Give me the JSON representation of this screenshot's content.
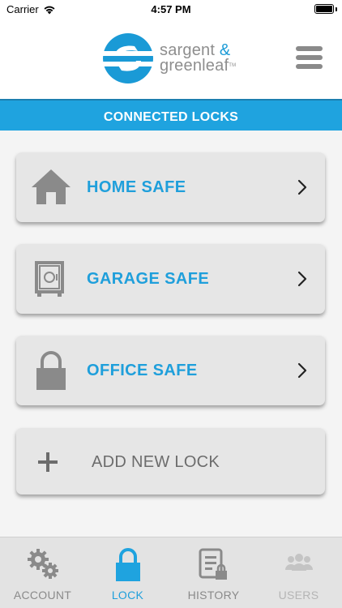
{
  "status_bar": {
    "carrier": "Carrier",
    "time": "4:57 PM"
  },
  "header": {
    "logo_line1": "sargent",
    "logo_amp": "&",
    "logo_line2": "greenleaf",
    "logo_tm": "TM",
    "menu_icon": "hamburger-menu-icon"
  },
  "section_title": "CONNECTED LOCKS",
  "locks": [
    {
      "label": "HOME SAFE",
      "icon": "house-icon"
    },
    {
      "label": "GARAGE SAFE",
      "icon": "safe-icon"
    },
    {
      "label": "OFFICE SAFE",
      "icon": "padlock-icon"
    }
  ],
  "add_lock": {
    "label": "ADD NEW LOCK",
    "icon": "plus-icon"
  },
  "tabs": [
    {
      "label": "ACCOUNT",
      "icon": "gears-icon",
      "state": "inactive"
    },
    {
      "label": "LOCK",
      "icon": "padlock-icon",
      "state": "active"
    },
    {
      "label": "HISTORY",
      "icon": "history-icon",
      "state": "inactive"
    },
    {
      "label": "USERS",
      "icon": "users-icon",
      "state": "disabled"
    }
  ],
  "colors": {
    "accent": "#1fa3df",
    "icon_gray": "#8a8a8a",
    "card_bg": "#e6e6e6",
    "tab_disabled": "#b5b5b5"
  }
}
